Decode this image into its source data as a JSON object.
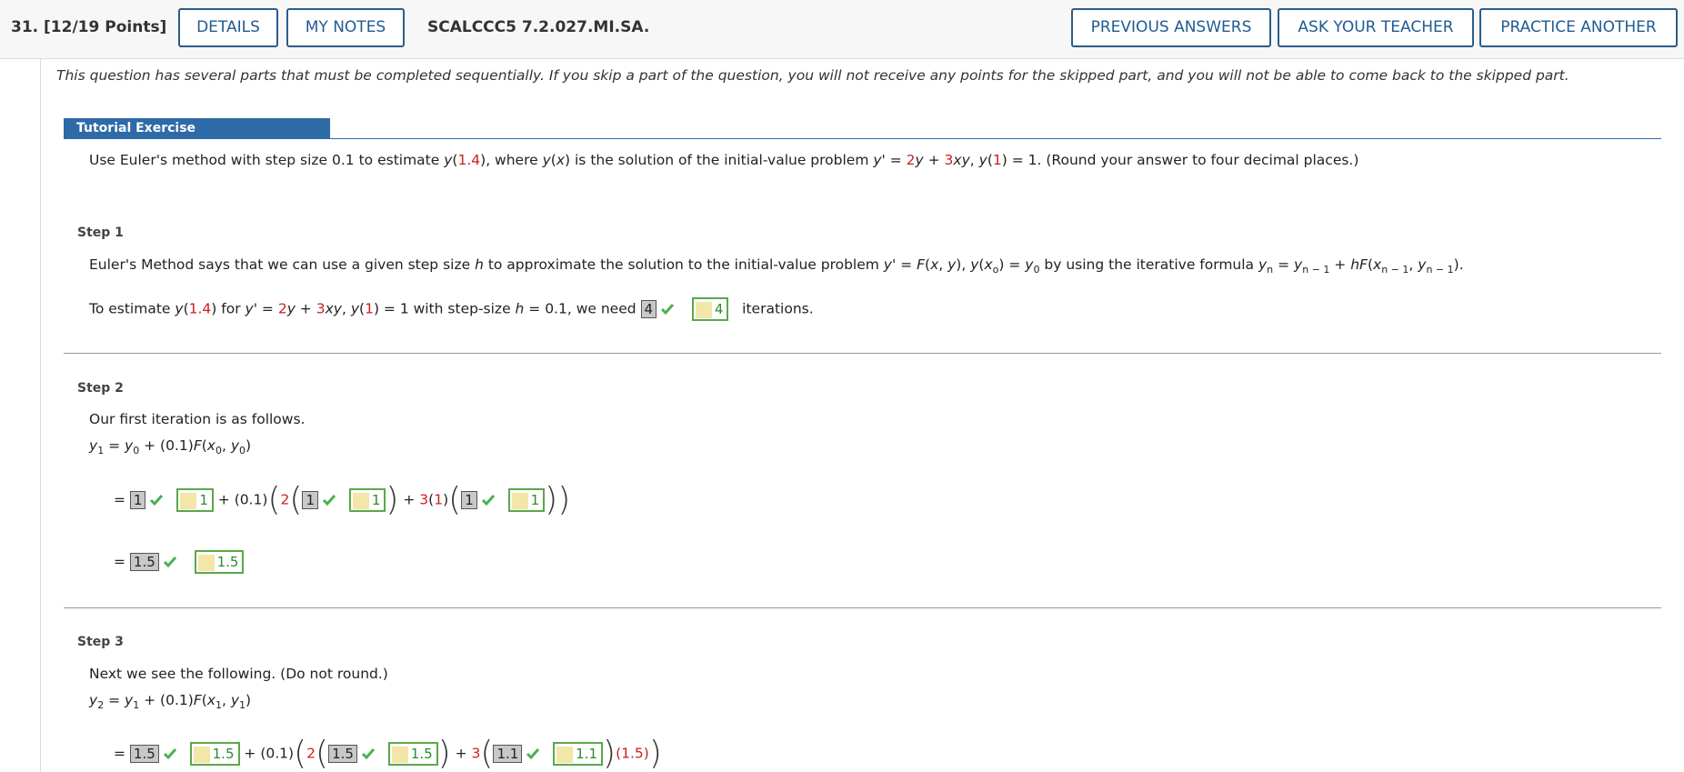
{
  "header": {
    "question_label": "31.  [12/19 Points]",
    "details_label": "DETAILS",
    "my_notes_label": "MY NOTES",
    "code": "SCALCCC5 7.2.027.MI.SA.",
    "previous_answers_label": "PREVIOUS ANSWERS",
    "ask_teacher_label": "ASK YOUR TEACHER",
    "practice_label": "PRACTICE ANOTHER"
  },
  "notice": "This question has several parts that must be completed sequentially. If you skip a part of the question, you will not receive any points for the skipped part, and you will not be able to come back to the skipped part.",
  "tutorial": {
    "label": "Tutorial Exercise",
    "problem_a": "Use Euler's method with step size 0.1 to estimate ",
    "problem_b": ", where ",
    "problem_c": " is the solution of the initial-value problem ",
    "problem_d": "(Round your answer to four decimal places.)"
  },
  "step1": {
    "title": "Step 1",
    "intro": "Euler's Method says that we can use a given step size ",
    "intro_b": " to approximate the solution to the initial-value problem ",
    "intro_c": " by using the iterative formula ",
    "est_a": "To estimate ",
    "est_b": " for ",
    "est_c": " with step-size ",
    "est_d": " = 0.1, we need ",
    "answer": "4",
    "key": "4",
    "est_e": "iterations."
  },
  "step2": {
    "title": "Step 2",
    "intro": "Our first iteration is as follows.",
    "a1": "1",
    "k1": "1",
    "a2": "1",
    "k2": "1",
    "a3": "1",
    "k3": "1",
    "result": "1.5",
    "kresult": "1.5"
  },
  "step3": {
    "title": "Step 3",
    "intro": "Next we see the following. (Do not round.)",
    "a1": "1.5",
    "k1": "1.5",
    "a2": "1.5",
    "k2": "1.5",
    "a3": "1.1",
    "k3": "1.1",
    "tail": "(1.5)"
  },
  "colors": {
    "accent": "#2e6aa8",
    "button_border": "#2b5c8a",
    "red": "#cc1f1f",
    "correct": "#4caf50"
  }
}
